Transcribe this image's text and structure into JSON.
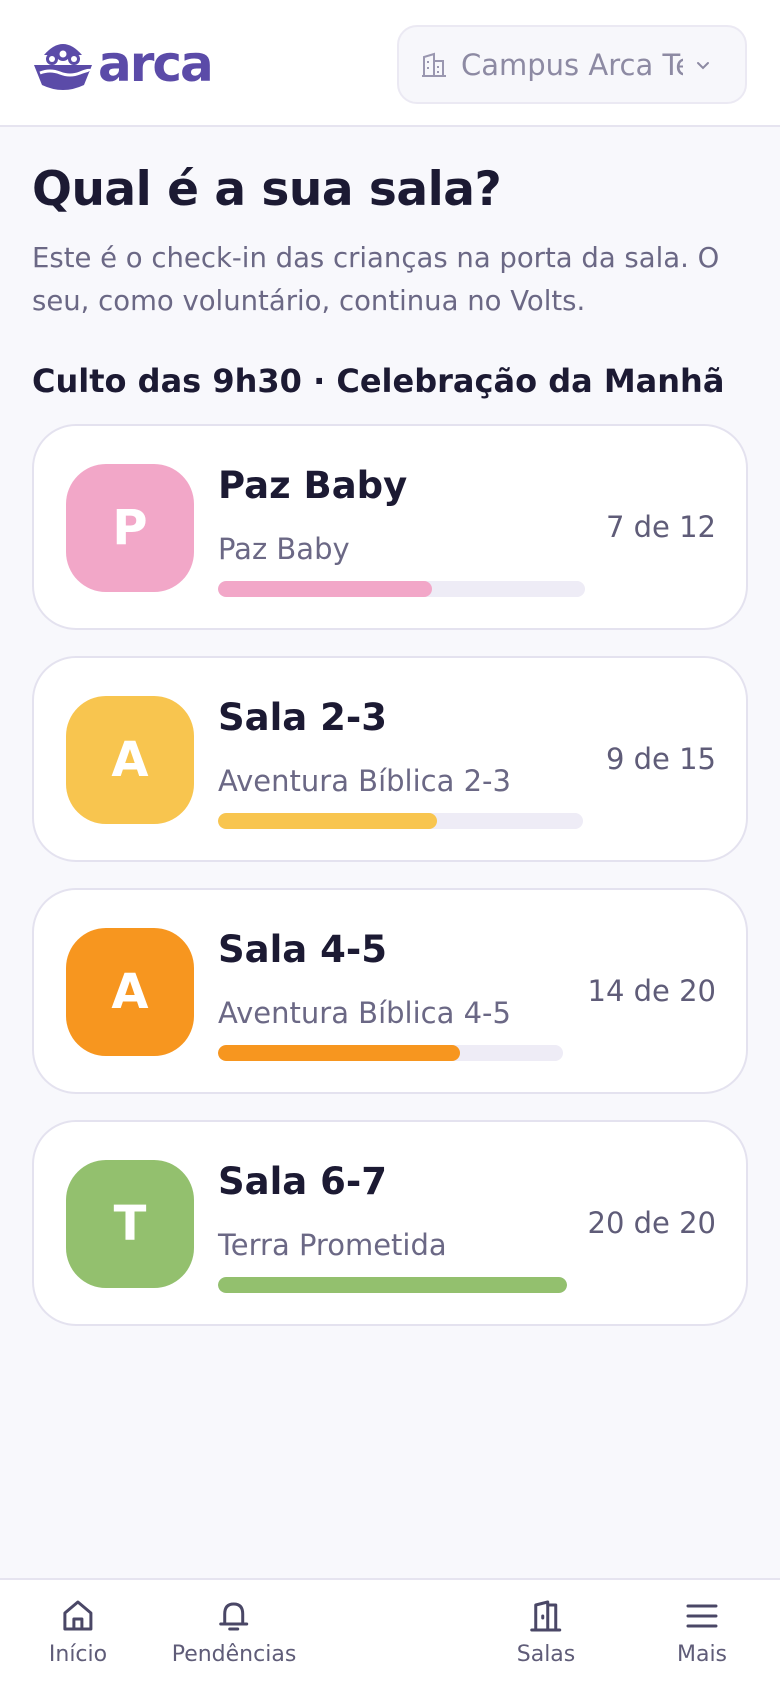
{
  "app": {
    "brand": "arca",
    "brand_color": "#5b4ba8"
  },
  "header": {
    "campus_label": "Campus Arca Teste",
    "campus_icon": "building-icon",
    "dropdown_icon": "chevron-down-icon"
  },
  "main": {
    "title": "Qual é a sua sala?",
    "subtitle": "Este é o check-in das crianças na porta da sala. O seu, como voluntário, continua no Volts.",
    "service_label": "Culto das 9h30 · Celebração da Manhã"
  },
  "rooms": [
    {
      "initial": "P",
      "name": "Paz Baby",
      "class_name": "Paz Baby",
      "count": "7 de 12",
      "checked_in": 7,
      "capacity": 12,
      "color": "#f2a7c8"
    },
    {
      "initial": "A",
      "name": "Sala 2-3",
      "class_name": "Aventura Bíblica 2-3",
      "count": "9 de 15",
      "checked_in": 9,
      "capacity": 15,
      "color": "#f8c54f"
    },
    {
      "initial": "A",
      "name": "Sala 4-5",
      "class_name": "Aventura Bíblica 4-5",
      "count": "14 de 20",
      "checked_in": 14,
      "capacity": 20,
      "color": "#f7961f"
    },
    {
      "initial": "T",
      "name": "Sala 6-7",
      "class_name": "Terra Prometida",
      "count": "20 de 20",
      "checked_in": 20,
      "capacity": 20,
      "color": "#93c06e"
    }
  ],
  "tabbar": {
    "items": [
      {
        "label": "Início",
        "icon": "home-icon"
      },
      {
        "label": "Pendências",
        "icon": "bell-icon"
      },
      {
        "label": "Salas",
        "icon": "door-icon"
      },
      {
        "label": "Mais",
        "icon": "menu-icon"
      }
    ]
  }
}
